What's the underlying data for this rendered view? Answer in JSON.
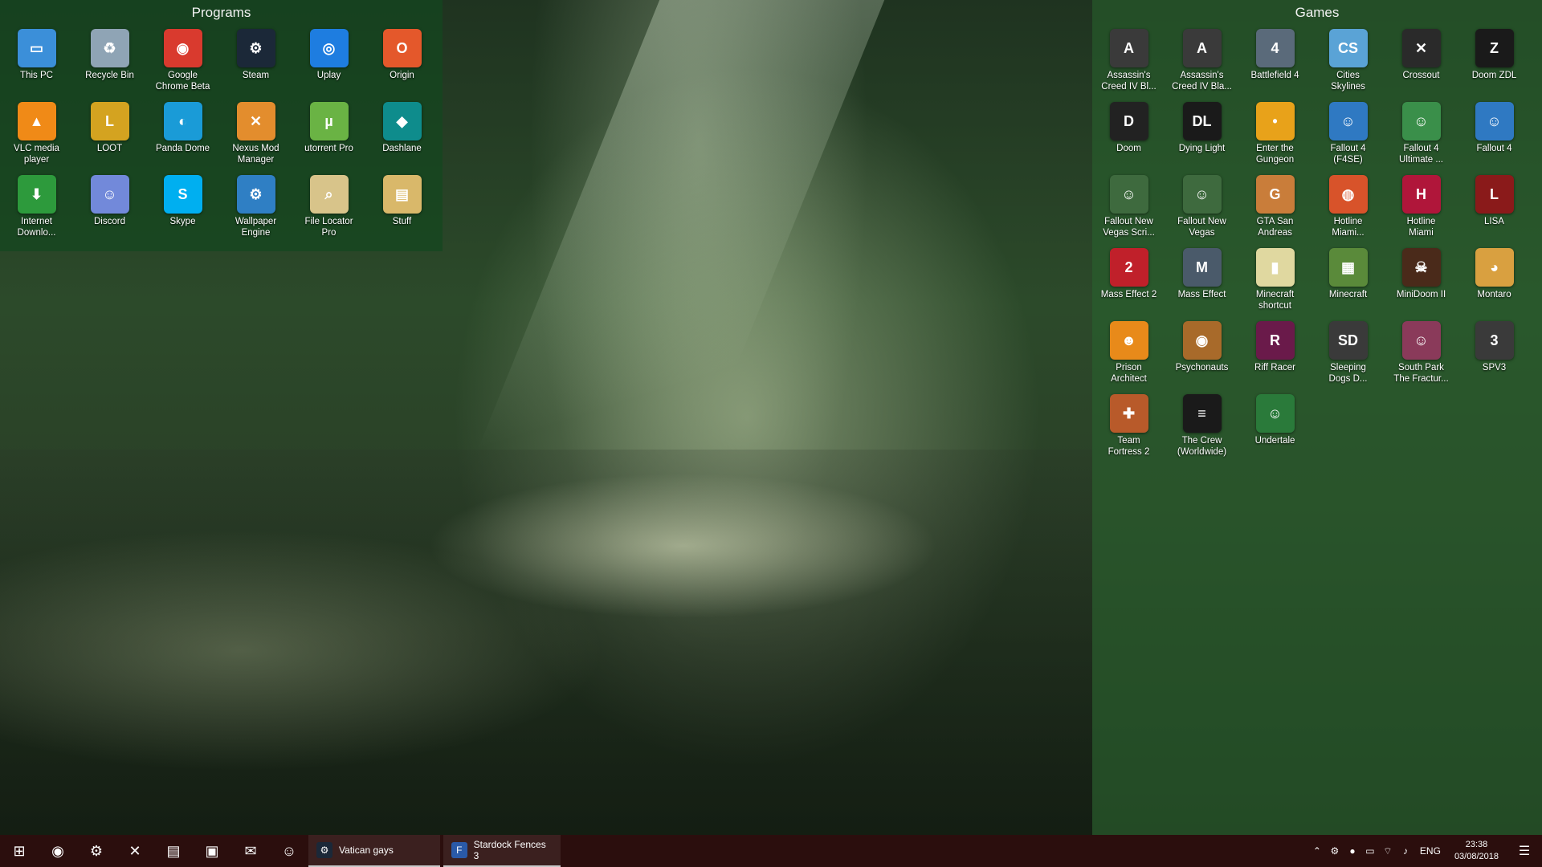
{
  "desktop": {
    "fences": {
      "programs": {
        "title": "Programs",
        "items": [
          {
            "label": "This PC",
            "icon": "computer-icon",
            "color": "#3b8fd9",
            "glyph": "▭"
          },
          {
            "label": "Recycle Bin",
            "icon": "recycle-bin-icon",
            "color": "#8fa4b5",
            "glyph": "♻"
          },
          {
            "label": "Google\nChrome Beta",
            "icon": "chrome-beta-icon",
            "color": "#d93a2e",
            "glyph": "◉"
          },
          {
            "label": "Steam",
            "icon": "steam-icon",
            "color": "#1b2838",
            "glyph": "⚙"
          },
          {
            "label": "Uplay",
            "icon": "uplay-icon",
            "color": "#1e7de0",
            "glyph": "◎"
          },
          {
            "label": "Origin",
            "icon": "origin-icon",
            "color": "#e4582b",
            "glyph": "O"
          },
          {
            "label": "VLC media\nplayer",
            "icon": "vlc-icon",
            "color": "#f08a17",
            "glyph": "▲"
          },
          {
            "label": "LOOT",
            "icon": "loot-icon",
            "color": "#d4a320",
            "glyph": "L"
          },
          {
            "label": "Panda Dome",
            "icon": "panda-dome-icon",
            "color": "#1a9bd7",
            "glyph": "◐"
          },
          {
            "label": "Nexus Mod\nManager",
            "icon": "nexus-mod-manager-icon",
            "color": "#e38d2d",
            "glyph": "✕"
          },
          {
            "label": "utorrent Pro",
            "icon": "utorrent-icon",
            "color": "#6ab344",
            "glyph": "µ"
          },
          {
            "label": "Dashlane",
            "icon": "dashlane-icon",
            "color": "#0e8c8c",
            "glyph": "◆"
          },
          {
            "label": "Internet\nDownlo...",
            "icon": "internet-download-manager-icon",
            "color": "#2d9a3c",
            "glyph": "⬇"
          },
          {
            "label": "Discord",
            "icon": "discord-icon",
            "color": "#7289da",
            "glyph": "☺"
          },
          {
            "label": "Skype",
            "icon": "skype-icon",
            "color": "#00aff0",
            "glyph": "S"
          },
          {
            "label": "Wallpaper\nEngine",
            "icon": "wallpaper-engine-icon",
            "color": "#2f7fc4",
            "glyph": "⚙"
          },
          {
            "label": "File Locator\nPro",
            "icon": "file-locator-pro-icon",
            "color": "#d8c48a",
            "glyph": "⌕"
          },
          {
            "label": "Stuff",
            "icon": "folder-icon",
            "color": "#d9b86a",
            "glyph": "▤"
          }
        ]
      },
      "games": {
        "title": "Games",
        "items": [
          {
            "label": "Assassin's\nCreed IV Bl...",
            "icon": "assassins-creed-icon",
            "color": "#3a3a3a",
            "glyph": "A"
          },
          {
            "label": "Assassin's\nCreed IV Bla...",
            "icon": "assassins-creed-icon",
            "color": "#3a3a3a",
            "glyph": "A"
          },
          {
            "label": "Battlefield 4",
            "icon": "battlefield-4-icon",
            "color": "#5a6a7a",
            "glyph": "4"
          },
          {
            "label": "Cities\nSkylines",
            "icon": "cities-skylines-icon",
            "color": "#5aa3d6",
            "glyph": "CS"
          },
          {
            "label": "Crossout",
            "icon": "crossout-icon",
            "color": "#2a2a2a",
            "glyph": "✕"
          },
          {
            "label": "Doom ZDL",
            "icon": "doom-zdl-icon",
            "color": "#1a1a1a",
            "glyph": "Z"
          },
          {
            "label": "Doom",
            "icon": "doom-icon",
            "color": "#222222",
            "glyph": "D"
          },
          {
            "label": "Dying Light",
            "icon": "dying-light-icon",
            "color": "#1a1a1a",
            "glyph": "DL"
          },
          {
            "label": "Enter the\nGungeon",
            "icon": "enter-the-gungeon-icon",
            "color": "#e8a21a",
            "glyph": "•"
          },
          {
            "label": "Fallout 4\n(F4SE)",
            "icon": "fallout-4-icon",
            "color": "#2f79c2",
            "glyph": "☺"
          },
          {
            "label": "Fallout 4\nUltimate ...",
            "icon": "fallout-4-icon",
            "color": "#3a8f4a",
            "glyph": "☺"
          },
          {
            "label": "Fallout 4",
            "icon": "fallout-4-icon",
            "color": "#2f79c2",
            "glyph": "☺"
          },
          {
            "label": "Fallout New\nVegas Scri...",
            "icon": "fallout-new-vegas-icon",
            "color": "#3e6a3e",
            "glyph": "☺"
          },
          {
            "label": "Fallout New\nVegas",
            "icon": "fallout-new-vegas-icon",
            "color": "#3e6a3e",
            "glyph": "☺"
          },
          {
            "label": "GTA San\nAndreas",
            "icon": "gta-san-andreas-icon",
            "color": "#c97d3a",
            "glyph": "G"
          },
          {
            "label": "Hotline\nMiami...",
            "icon": "hotline-miami-icon",
            "color": "#d8532a",
            "glyph": "◍"
          },
          {
            "label": "Hotline\nMiami",
            "icon": "hotline-miami-icon",
            "color": "#b0163a",
            "glyph": "H"
          },
          {
            "label": "LISA",
            "icon": "lisa-icon",
            "color": "#8a1a1a",
            "glyph": "L"
          },
          {
            "label": "Mass Effect 2",
            "icon": "mass-effect-icon",
            "color": "#c0202a",
            "glyph": "2"
          },
          {
            "label": "Mass Effect",
            "icon": "mass-effect-icon",
            "color": "#4a5a6a",
            "glyph": "M"
          },
          {
            "label": "Minecraft\nshortcut",
            "icon": "minecraft-icon",
            "color": "#e0d8a0",
            "glyph": "▮"
          },
          {
            "label": "Minecraft",
            "icon": "minecraft-icon",
            "color": "#5a8a3a",
            "glyph": "▦"
          },
          {
            "label": "MiniDoom II",
            "icon": "minidoom-icon",
            "color": "#4a2a1a",
            "glyph": "☠"
          },
          {
            "label": "Montaro",
            "icon": "montaro-icon",
            "color": "#d9a040",
            "glyph": "◕"
          },
          {
            "label": "Prison\nArchitect",
            "icon": "prison-architect-icon",
            "color": "#e88a1a",
            "glyph": "☻"
          },
          {
            "label": "Psychonauts",
            "icon": "psychonauts-icon",
            "color": "#a86a2a",
            "glyph": "◉"
          },
          {
            "label": "Riff Racer",
            "icon": "riff-racer-icon",
            "color": "#6a1a4a",
            "glyph": "R"
          },
          {
            "label": "Sleeping\nDogs D...",
            "icon": "sleeping-dogs-icon",
            "color": "#3a3a3a",
            "glyph": "SD"
          },
          {
            "label": "South Park\nThe Fractur...",
            "icon": "south-park-icon",
            "color": "#8a3a5a",
            "glyph": "☺"
          },
          {
            "label": "SPV3",
            "icon": "spv3-icon",
            "color": "#3a3a3a",
            "glyph": "3"
          },
          {
            "label": "Team\nFortress 2",
            "icon": "team-fortress-2-icon",
            "color": "#b85a2a",
            "glyph": "✚"
          },
          {
            "label": "The Crew\n(Worldwide)",
            "icon": "the-crew-icon",
            "color": "#1a1a1a",
            "glyph": "≡"
          },
          {
            "label": "Undertale",
            "icon": "undertale-icon",
            "color": "#2a7a3a",
            "glyph": "☺"
          }
        ]
      }
    }
  },
  "taskbar": {
    "color": "#2b0e0d",
    "pinned": [
      {
        "name": "start-button",
        "icon": "windows-icon",
        "glyph": "⊞"
      },
      {
        "name": "taskbar-chrome",
        "icon": "chrome-icon",
        "glyph": "◉"
      },
      {
        "name": "taskbar-steam",
        "icon": "steam-icon",
        "glyph": "⚙"
      },
      {
        "name": "taskbar-nexus",
        "icon": "nexus-mod-manager-icon",
        "glyph": "✕"
      },
      {
        "name": "taskbar-file-explorer",
        "icon": "folder-icon",
        "glyph": "▤"
      },
      {
        "name": "taskbar-store",
        "icon": "store-icon",
        "glyph": "▣"
      },
      {
        "name": "taskbar-mail",
        "icon": "mail-icon",
        "glyph": "✉"
      },
      {
        "name": "taskbar-discord",
        "icon": "discord-icon",
        "glyph": "☺"
      }
    ],
    "open_apps": [
      {
        "label": "Vatican gays",
        "icon": "steam-icon",
        "glyph": "⚙"
      },
      {
        "label": "Stardock Fences 3",
        "icon": "fences-icon",
        "glyph": "F"
      }
    ],
    "tray": {
      "language": "ENG",
      "time": "23:38",
      "date": "03/08/2018"
    }
  }
}
